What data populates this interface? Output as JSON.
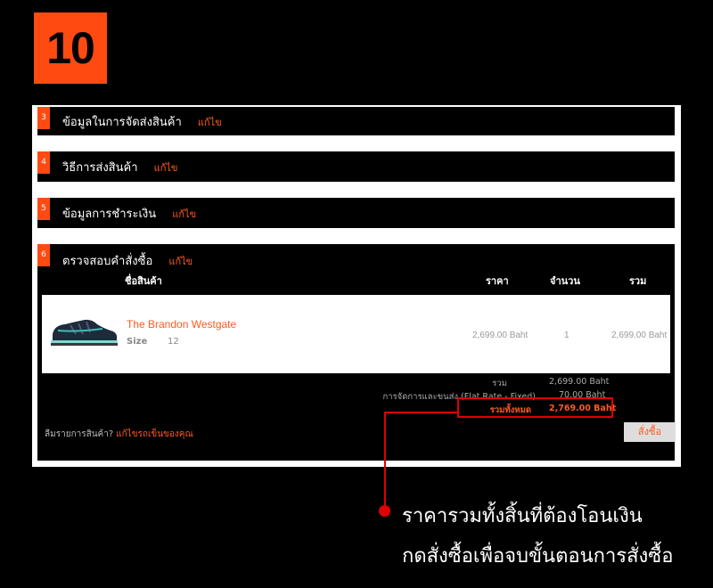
{
  "step_number": "10",
  "sections": [
    {
      "num": "3",
      "title": "ข้อมูลในการจัดส่งสินค้า",
      "edit": "แก้ไข"
    },
    {
      "num": "4",
      "title": "วิธีการส่งสินค้า",
      "edit": "แก้ไข"
    },
    {
      "num": "5",
      "title": "ข้อมูลการชำระเงิน",
      "edit": "แก้ไข"
    },
    {
      "num": "6",
      "title": "ตรวจสอบคำสั่งซื้อ",
      "edit": "แก้ไข"
    }
  ],
  "table": {
    "headers": {
      "product": "ชื่อสินค้า",
      "price": "ราคา",
      "qty": "จำนวน",
      "total": "รวม"
    },
    "item": {
      "name": "The Brandon Westgate",
      "size_label": "Size",
      "size_value": "12",
      "price": "2,699.00 Baht",
      "qty": "1",
      "total": "2,699.00 Baht"
    }
  },
  "summary": {
    "subtotal_label": "รวม",
    "subtotal_value": "2,699.00 Baht",
    "shipping_label": "การจัดการและขนส่ง (Flat Rate - Fixed)",
    "shipping_value": "70.00 Baht",
    "grand_label": "รวมทั้งหมด",
    "grand_value": "2,769.00 Baht"
  },
  "forgot_text": "ลืมรายการสินค้า?",
  "forgot_link": "แก้ไขรถเข็นของคุณ",
  "order_button": "สั่งซื้อ",
  "annotation": {
    "line1": "ราคารวมทั้งสิ้นที่ต้องโอนเงิน",
    "line2": "กดสั่งซื้อเพื่อจบขั้นตอนการสั่งซื้อ"
  },
  "colors": {
    "accent": "#ff4a12",
    "highlight": "#e00000",
    "link": "#ff5a1f"
  }
}
